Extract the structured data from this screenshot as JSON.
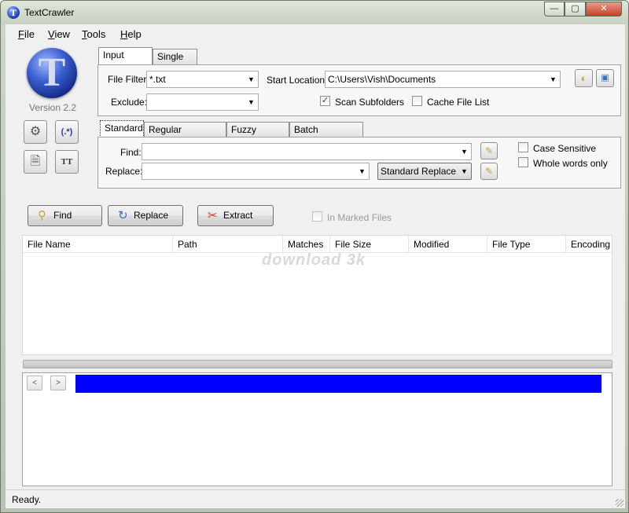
{
  "window": {
    "title": "TextCrawler",
    "icon_letter": "T",
    "minimize": "—",
    "maximize": "▢",
    "close": "✕"
  },
  "menu": [
    {
      "lead": "F",
      "rest": "ile"
    },
    {
      "lead": "V",
      "rest": "iew"
    },
    {
      "lead": "T",
      "rest": "ools"
    },
    {
      "lead": "H",
      "rest": "elp"
    }
  ],
  "logo": {
    "letter": "T",
    "version": "Version 2.2"
  },
  "sidebar_icons": {
    "settings": "⚙",
    "regex": "(.*)",
    "document": "🗎",
    "text": "TT"
  },
  "folder_tabs": {
    "input_folder": "Input Folder",
    "single_file": "Single File"
  },
  "folder_panel": {
    "file_filter_label": "File Filter:",
    "file_filter_value": "*.txt",
    "exclude_label": "Exclude:",
    "exclude_value": "",
    "start_location_label": "Start Location:",
    "start_location_value": "C:\\Users\\Vish\\Documents",
    "scan_subfolders_label": "Scan Subfolders",
    "scan_subfolders_checked": "✓",
    "cache_file_list_label": "Cache File List"
  },
  "search_tabs": {
    "standard": "Standard",
    "regex": "Regular Expression",
    "fuzzy": "Fuzzy Search",
    "batch": "Batch Commands"
  },
  "search_panel": {
    "find_label": "Find:",
    "find_value": "",
    "replace_label": "Replace:",
    "replace_value": "",
    "replace_mode": "Standard Replace",
    "case_sensitive_label": "Case Sensitive",
    "whole_words_label": "Whole words only"
  },
  "actions": {
    "find": "Find",
    "replace": "Replace",
    "extract": "Extract",
    "in_marked_files": "In Marked Files"
  },
  "results": {
    "columns": [
      "File Name",
      "Path",
      "Matches",
      "File Size",
      "Modified",
      "File Type",
      "Encoding"
    ],
    "watermark": "download 3k"
  },
  "preview_nav": {
    "prev": "<",
    "next": ">"
  },
  "status": {
    "text": "Ready."
  }
}
